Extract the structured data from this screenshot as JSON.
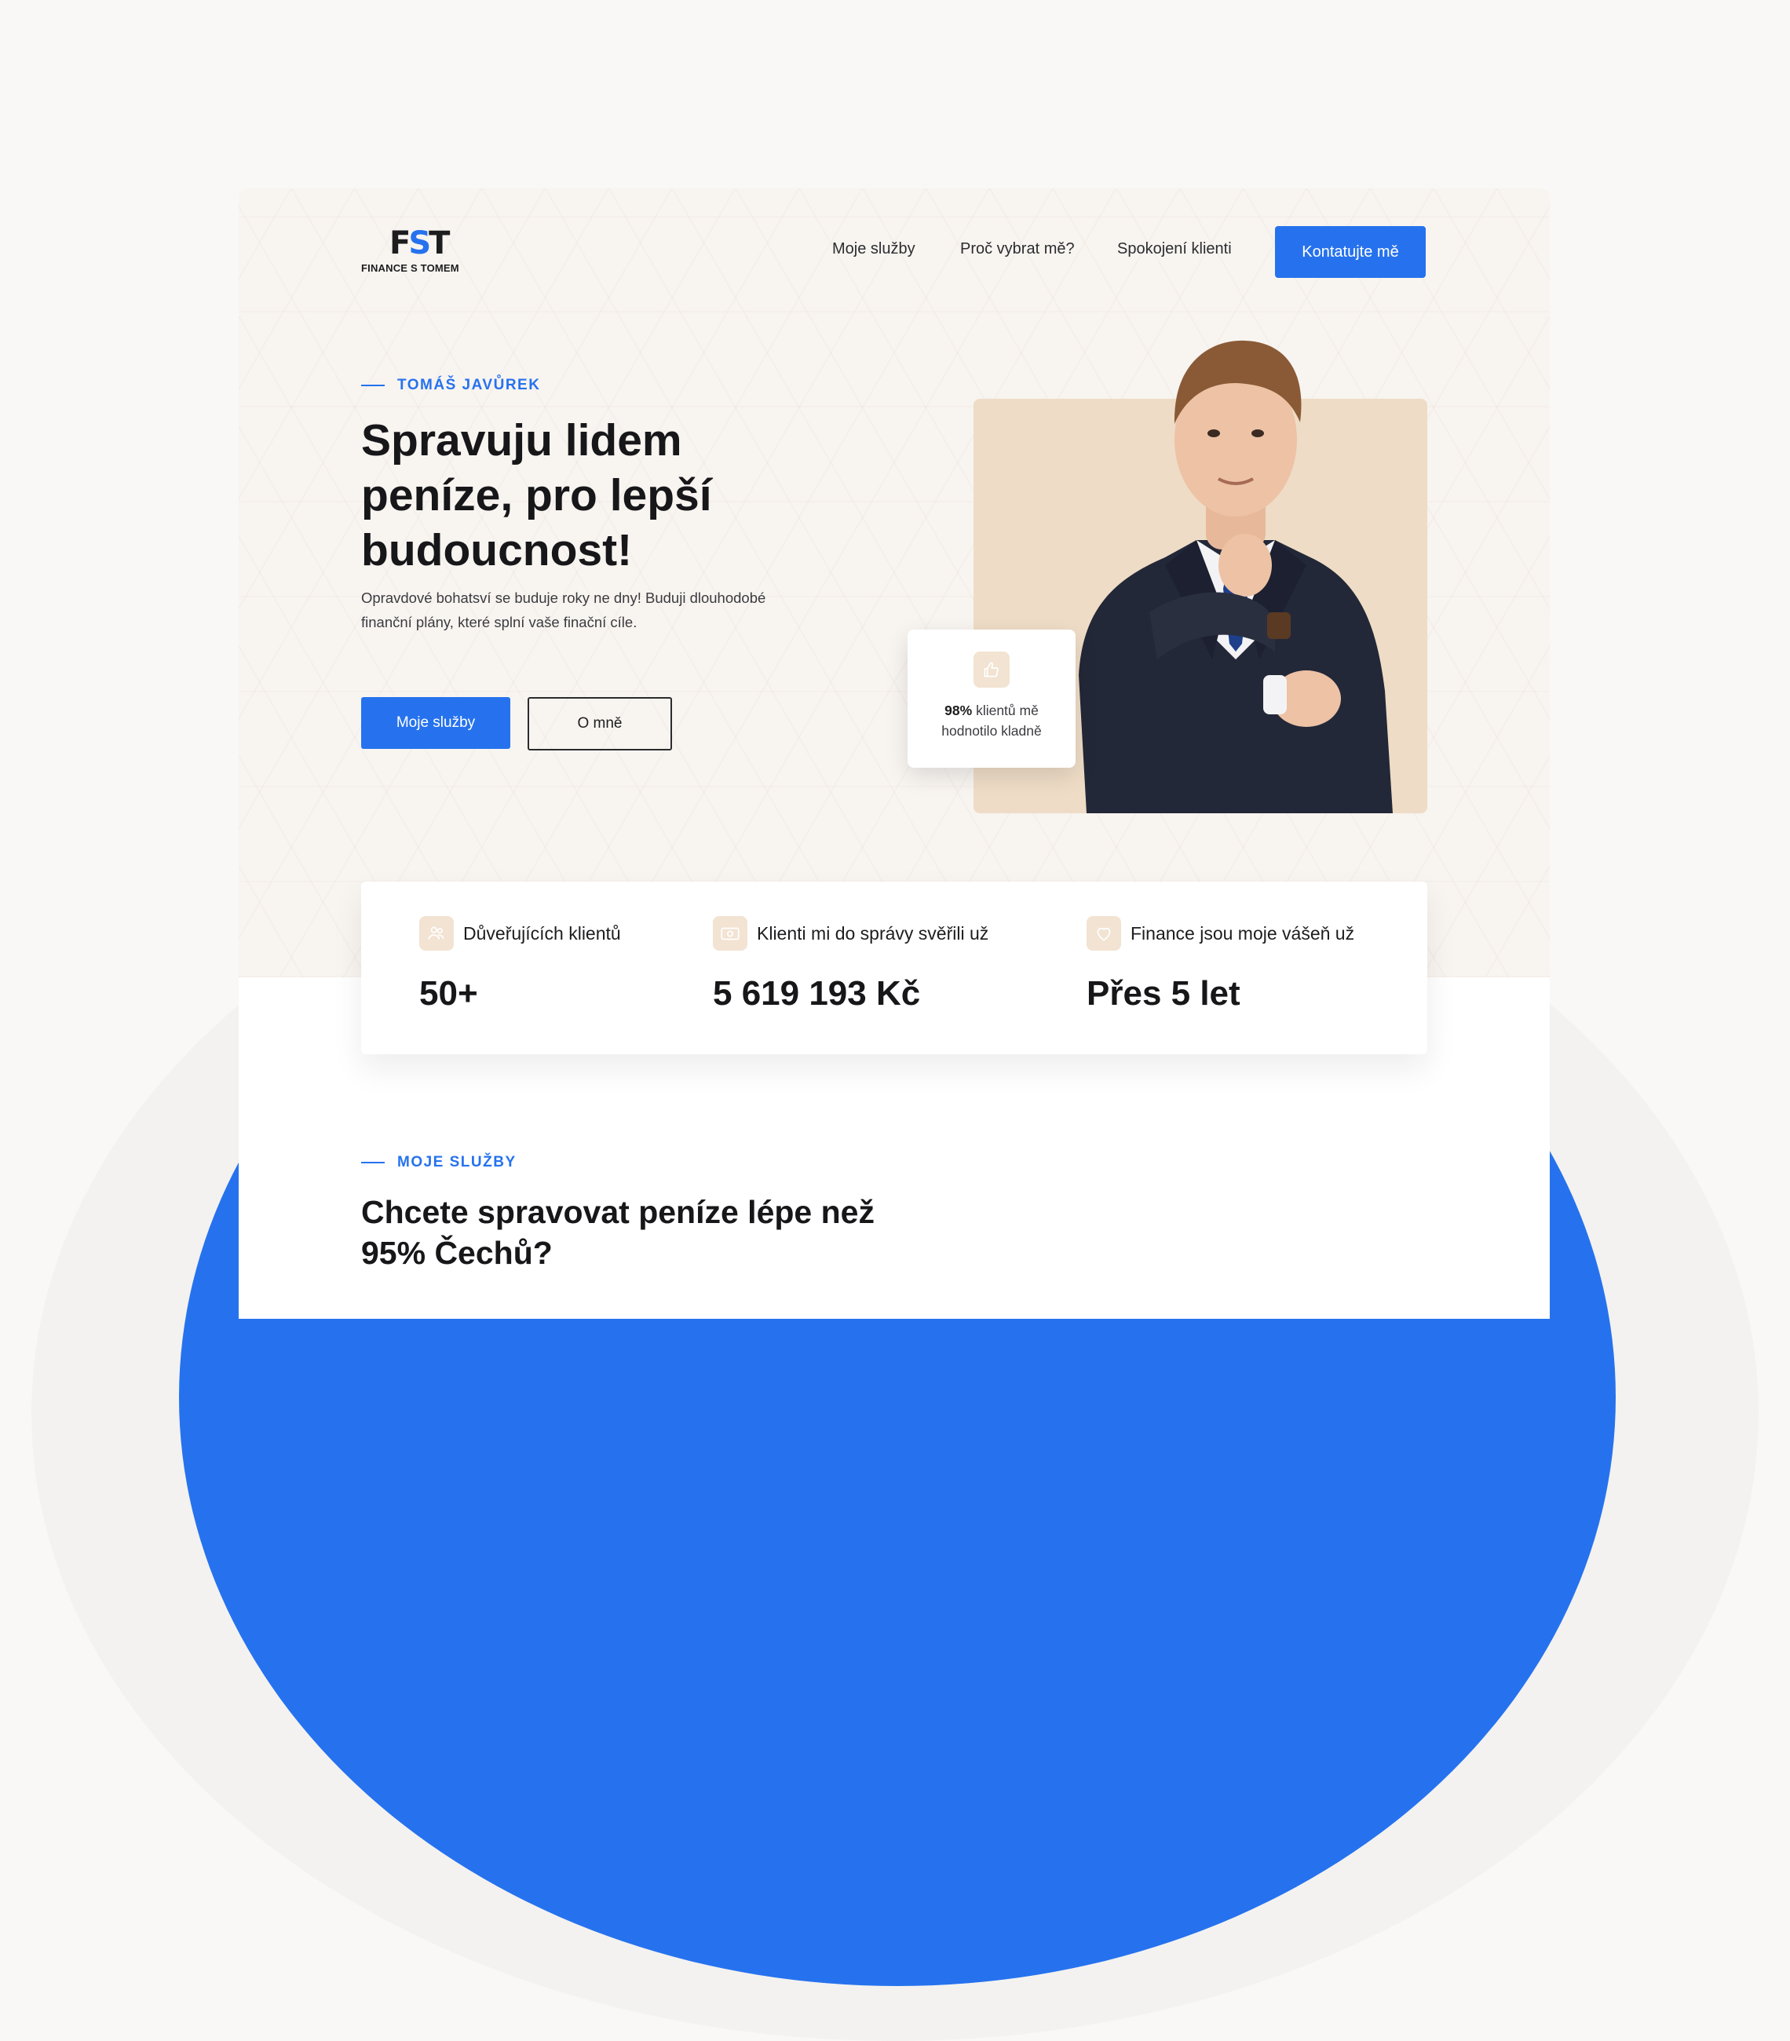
{
  "brand": {
    "mark": "FST",
    "name": "FINANCE S TOMEM"
  },
  "nav": {
    "items": [
      "Moje služby",
      "Proč vybrat mě?",
      "Spokojení klienti"
    ],
    "cta": "Kontatujte mě"
  },
  "hero": {
    "eyebrow": "TOMÁŠ JAVŮREK",
    "title": "Spravuju lidem peníze, pro lepší budoucnost!",
    "description": "Opravdové bohatsví se buduje roky ne dny! Buduji dlouhodobé finanční plány, které splní vaše finační cíle.",
    "primary_button": "Moje služby",
    "secondary_button": "O mně"
  },
  "rating": {
    "percent": "98%",
    "text_line1": "klientů mě",
    "text_line2": "hodnotilo kladně",
    "icon": "thumbs-up-icon"
  },
  "stats": [
    {
      "label": "Důveřujících klientů",
      "value": "50+",
      "icon": "users-icon"
    },
    {
      "label": "Klienti mi do správy svěřili už",
      "value": "5 619 193 Kč",
      "icon": "money-icon"
    },
    {
      "label": "Finance jsou moje vášeň už",
      "value": "Přes 5 let",
      "icon": "heart-icon"
    }
  ],
  "services": {
    "eyebrow": "MOJE SLUŽBY",
    "title": "Chcete spravovat peníze lépe než 95% Čechů?"
  },
  "colors": {
    "accent": "#2672ee",
    "hero_bg": "#f8f4f0",
    "photo_bg": "#eedcc6",
    "icon_bg": "#f2e3d2"
  }
}
